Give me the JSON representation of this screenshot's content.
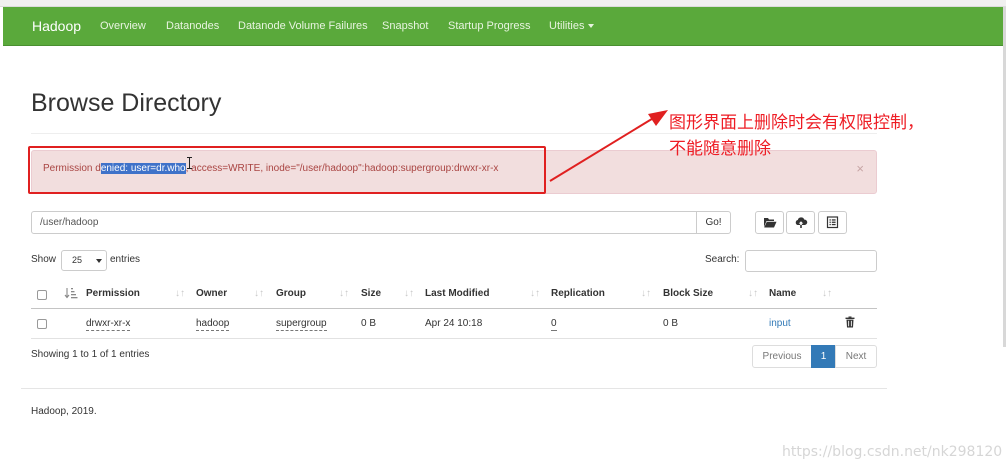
{
  "navbar": {
    "brand": "Hadoop",
    "items": [
      "Overview",
      "Datanodes",
      "Datanode Volume Failures",
      "Snapshot",
      "Startup Progress",
      "Utilities"
    ]
  },
  "page": {
    "title": "Browse Directory"
  },
  "alert": {
    "prefix": "Permission d",
    "selected": "enied: user=dr.who",
    "suffix": ", access=WRITE, inode=\"/user/hadoop\":hadoop:supergroup:drwxr-xr-x",
    "close": "×"
  },
  "annotation": {
    "line1": "图形界面上删除时会有权限控制，",
    "line2": "不能随意删除",
    "color": "#ee1c24"
  },
  "pathbar": {
    "value": "/user/hadoop",
    "go_label": "Go!",
    "icons": [
      "folder-open-icon",
      "cloud-upload-icon",
      "list-alt-icon"
    ]
  },
  "table_controls": {
    "show_label": "Show",
    "entries_value": "25",
    "entries_label": "entries",
    "search_label": "Search:"
  },
  "table": {
    "headers": [
      "Permission",
      "Owner",
      "Group",
      "Size",
      "Last Modified",
      "Replication",
      "Block Size",
      "Name"
    ],
    "rows": [
      {
        "permission": "drwxr-xr-x",
        "owner": "hadoop",
        "group": "supergroup",
        "size": "0 B",
        "last_modified": "Apr 24 10:18",
        "replication": "0",
        "block_size": "0 B",
        "name": "input"
      }
    ]
  },
  "pagination": {
    "info": "Showing 1 to 1 of 1 entries",
    "previous": "Previous",
    "current": "1",
    "next": "Next"
  },
  "footer": {
    "text": "Hadoop, 2019."
  },
  "watermark": "https://blog.csdn.net/nk298120",
  "colors": {
    "navbar": "#5aa93b",
    "alert_bg": "#f2dede",
    "alert_text": "#a94442",
    "link": "#337ab7",
    "highlight_box": "#e02020"
  }
}
